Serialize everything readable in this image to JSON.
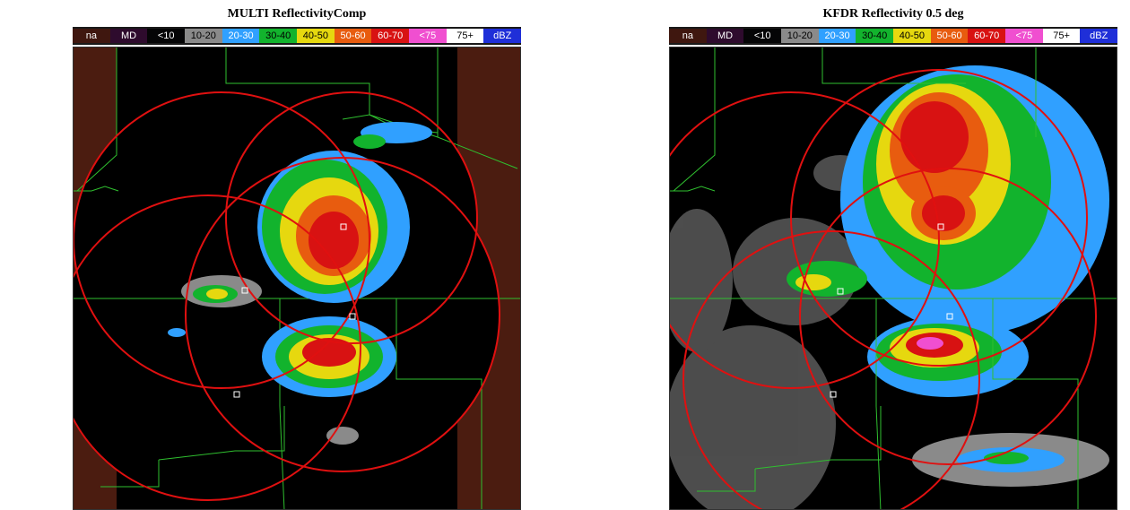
{
  "legend": [
    {
      "label": "na",
      "bg": "#3f170f",
      "fg": "#ffffff"
    },
    {
      "label": "MD",
      "bg": "#2e0b2d",
      "fg": "#ffffff"
    },
    {
      "label": "<10",
      "bg": "#050506",
      "fg": "#ffffff"
    },
    {
      "label": "10-20",
      "bg": "#8a8a8a",
      "fg": "#000000"
    },
    {
      "label": "20-30",
      "bg": "#30a0ff",
      "fg": "#ffffff"
    },
    {
      "label": "30-40",
      "bg": "#12b32d",
      "fg": "#000000"
    },
    {
      "label": "40-50",
      "bg": "#e6d80f",
      "fg": "#000000"
    },
    {
      "label": "50-60",
      "bg": "#e85c0f",
      "fg": "#ffffff"
    },
    {
      "label": "60-70",
      "bg": "#d81212",
      "fg": "#ffffff"
    },
    {
      "label": "<75",
      "bg": "#f04fd0",
      "fg": "#ffffff"
    },
    {
      "label": "75+",
      "bg": "#ffffff",
      "fg": "#000000"
    },
    {
      "label": "dBZ",
      "bg": "#1f2fd8",
      "fg": "#ffffff"
    }
  ],
  "panels": [
    {
      "title": "MULTI ReflectivityComp"
    },
    {
      "title": "KFDR Reflectivity 0.5 deg"
    }
  ],
  "colors": {
    "outside_area": "#4b1c10",
    "radar_background": "#000000",
    "range_ring": "#e01010",
    "county_line": "#2fbf2f"
  }
}
